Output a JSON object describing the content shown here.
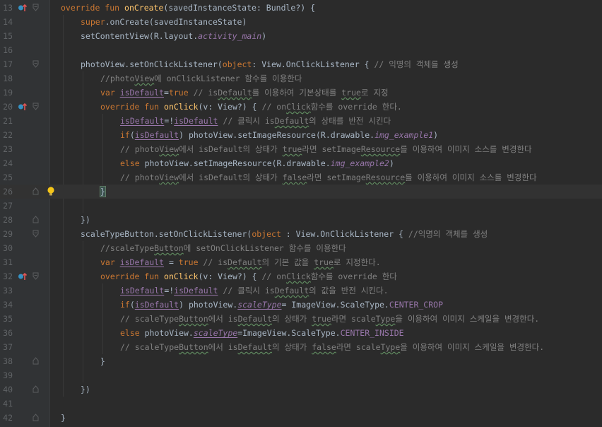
{
  "colors": {
    "background": "#2b2b2b",
    "gutter": "#313335",
    "keyword": "#cc7832",
    "function": "#ffc66d",
    "comment": "#808080",
    "field": "#9876aa",
    "text": "#a9b7c6",
    "line_number": "#606366"
  },
  "editor": {
    "lines": [
      {
        "num": "13",
        "marker": "override-up-icon",
        "fold": "fold-open-icon",
        "indent": 0,
        "tokens": [
          {
            "t": "override fun ",
            "c": "kw"
          },
          {
            "t": "onCreate",
            "c": "fn"
          },
          {
            "t": "(savedInstanceState: Bundle?) {",
            "c": ""
          }
        ]
      },
      {
        "num": "14",
        "indent": 1,
        "tokens": [
          {
            "t": "super",
            "c": "kw"
          },
          {
            "t": ".onCreate(savedInstanceState)",
            "c": ""
          }
        ]
      },
      {
        "num": "15",
        "indent": 1,
        "tokens": [
          {
            "t": "setContentView(R.layout.",
            "c": ""
          },
          {
            "t": "activity_main",
            "c": "res"
          },
          {
            "t": ")",
            "c": ""
          }
        ]
      },
      {
        "num": "16",
        "indent": 0,
        "tokens": []
      },
      {
        "num": "17",
        "fold": "fold-open-icon",
        "indent": 1,
        "tokens": [
          {
            "t": "photoView.setOnClickListener(",
            "c": ""
          },
          {
            "t": "object",
            "c": "kw"
          },
          {
            "t": ": View.OnClickListener { ",
            "c": ""
          },
          {
            "t": "// 익명의 객체를 생성",
            "c": "cm"
          }
        ]
      },
      {
        "num": "18",
        "indent": 2,
        "tokens": [
          {
            "t": "//photo",
            "c": "cm"
          },
          {
            "t": "View",
            "c": "cm squig"
          },
          {
            "t": "에 onClickListener 함수를 이용한다",
            "c": "cm"
          }
        ]
      },
      {
        "num": "19",
        "indent": 2,
        "tokens": [
          {
            "t": "var ",
            "c": "kw"
          },
          {
            "t": "isDefault",
            "c": "prop uline"
          },
          {
            "t": "=",
            "c": ""
          },
          {
            "t": "true ",
            "c": "kw"
          },
          {
            "t": "// is",
            "c": "cm"
          },
          {
            "t": "Default",
            "c": "cm squig"
          },
          {
            "t": "를 이용하여 기본상태를 ",
            "c": "cm"
          },
          {
            "t": "true",
            "c": "cm squig"
          },
          {
            "t": "로 지정",
            "c": "cm"
          }
        ]
      },
      {
        "num": "20",
        "marker": "override-up-icon",
        "fold": "fold-open-icon",
        "indent": 2,
        "tokens": [
          {
            "t": "override fun ",
            "c": "kw"
          },
          {
            "t": "onClick",
            "c": "fn"
          },
          {
            "t": "(v: View?) ",
            "c": ""
          },
          {
            "t": "{",
            "c": "brace"
          },
          {
            "t": " // on",
            "c": "cm"
          },
          {
            "t": "Click",
            "c": "cm squig"
          },
          {
            "t": "함수를 override 한다.",
            "c": "cm"
          }
        ]
      },
      {
        "num": "21",
        "indent": 3,
        "tokens": [
          {
            "t": "isDefault",
            "c": "prop uline"
          },
          {
            "t": "=!",
            "c": ""
          },
          {
            "t": "isDefault",
            "c": "prop uline"
          },
          {
            "t": " // 클릭시 is",
            "c": "cm"
          },
          {
            "t": "Default",
            "c": "cm squig"
          },
          {
            "t": "의 상태를 반전 시킨다",
            "c": "cm"
          }
        ]
      },
      {
        "num": "22",
        "indent": 3,
        "tokens": [
          {
            "t": "if",
            "c": "kw"
          },
          {
            "t": "(",
            "c": ""
          },
          {
            "t": "isDefault",
            "c": "prop uline"
          },
          {
            "t": ") photoView.setImageResource(R.drawable.",
            "c": ""
          },
          {
            "t": "img_example1",
            "c": "res"
          },
          {
            "t": ")",
            "c": ""
          }
        ]
      },
      {
        "num": "23",
        "indent": 3,
        "tokens": [
          {
            "t": "// photo",
            "c": "cm"
          },
          {
            "t": "View",
            "c": "cm squig"
          },
          {
            "t": "에서 isDefault의 상태가 ",
            "c": "cm"
          },
          {
            "t": "true",
            "c": "cm squig"
          },
          {
            "t": "라면 setImage",
            "c": "cm"
          },
          {
            "t": "Resource",
            "c": "cm squig"
          },
          {
            "t": "를 이용하여 이미지 소스를 변경한다",
            "c": "cm"
          }
        ]
      },
      {
        "num": "24",
        "indent": 3,
        "tokens": [
          {
            "t": "else ",
            "c": "kw"
          },
          {
            "t": "photoView.setImageResource(R.drawable.",
            "c": ""
          },
          {
            "t": "img_example2",
            "c": "res"
          },
          {
            "t": ")",
            "c": ""
          }
        ]
      },
      {
        "num": "25",
        "indent": 3,
        "tokens": [
          {
            "t": "// photo",
            "c": "cm"
          },
          {
            "t": "View",
            "c": "cm squig"
          },
          {
            "t": "에서 isDefault의 상태가 ",
            "c": "cm"
          },
          {
            "t": "false",
            "c": "cm squig"
          },
          {
            "t": "라면 setImage",
            "c": "cm"
          },
          {
            "t": "Resource",
            "c": "cm squig"
          },
          {
            "t": "를 이용하여 이미지 소스를 변경한다",
            "c": "cm"
          }
        ]
      },
      {
        "num": "26",
        "fold": "fold-close-icon",
        "bulb": "lightbulb-icon",
        "current": true,
        "indent": 2,
        "tokens": [
          {
            "t": "}",
            "c": "brace"
          }
        ]
      },
      {
        "num": "27",
        "indent": 0,
        "tokens": []
      },
      {
        "num": "28",
        "fold": "fold-close-icon",
        "indent": 1,
        "tokens": [
          {
            "t": "})",
            "c": ""
          }
        ]
      },
      {
        "num": "29",
        "fold": "fold-open-icon",
        "indent": 1,
        "tokens": [
          {
            "t": "scaleTypeButton.setOnClickListener(",
            "c": ""
          },
          {
            "t": "object",
            "c": "kw"
          },
          {
            "t": " : View.OnClickListener { ",
            "c": ""
          },
          {
            "t": "//익명의 객체를 생성",
            "c": "cm"
          }
        ]
      },
      {
        "num": "30",
        "indent": 2,
        "tokens": [
          {
            "t": "//scaleType",
            "c": "cm"
          },
          {
            "t": "Button",
            "c": "cm squig"
          },
          {
            "t": "에 setOnClickListener 함수를 이용한다",
            "c": "cm"
          }
        ]
      },
      {
        "num": "31",
        "indent": 2,
        "tokens": [
          {
            "t": "var ",
            "c": "kw"
          },
          {
            "t": "isDefault",
            "c": "prop uline"
          },
          {
            "t": " = ",
            "c": ""
          },
          {
            "t": "true ",
            "c": "kw"
          },
          {
            "t": "// is",
            "c": "cm"
          },
          {
            "t": "Default",
            "c": "cm squig"
          },
          {
            "t": "의 기본 값을 ",
            "c": "cm"
          },
          {
            "t": "true",
            "c": "cm squig"
          },
          {
            "t": "로 지정한다.",
            "c": "cm"
          }
        ]
      },
      {
        "num": "32",
        "marker": "override-up-icon",
        "fold": "fold-open-icon",
        "indent": 2,
        "tokens": [
          {
            "t": "override fun ",
            "c": "kw"
          },
          {
            "t": "onClick",
            "c": "fn"
          },
          {
            "t": "(v: View?) { ",
            "c": ""
          },
          {
            "t": "// on",
            "c": "cm"
          },
          {
            "t": "Click",
            "c": "cm squig"
          },
          {
            "t": "함수를 override 한다",
            "c": "cm"
          }
        ]
      },
      {
        "num": "33",
        "indent": 3,
        "tokens": [
          {
            "t": "isDefault",
            "c": "prop uline"
          },
          {
            "t": "=!",
            "c": ""
          },
          {
            "t": "isDefault",
            "c": "prop uline"
          },
          {
            "t": " // 클릭시 is",
            "c": "cm"
          },
          {
            "t": "Default",
            "c": "cm squig"
          },
          {
            "t": "의 값을 반전 시킨다.",
            "c": "cm"
          }
        ]
      },
      {
        "num": "34",
        "indent": 3,
        "tokens": [
          {
            "t": "if",
            "c": "kw"
          },
          {
            "t": "(",
            "c": ""
          },
          {
            "t": "isDefault",
            "c": "prop uline"
          },
          {
            "t": ") photoView.",
            "c": ""
          },
          {
            "t": "scaleType",
            "c": "res uline"
          },
          {
            "t": "= ImageView.ScaleType.",
            "c": ""
          },
          {
            "t": "CENTER_CROP",
            "c": "prop"
          }
        ]
      },
      {
        "num": "35",
        "indent": 3,
        "tokens": [
          {
            "t": "// scaleType",
            "c": "cm"
          },
          {
            "t": "Button",
            "c": "cm squig"
          },
          {
            "t": "에서 is",
            "c": "cm"
          },
          {
            "t": "Default",
            "c": "cm squig"
          },
          {
            "t": "의 상태가 ",
            "c": "cm"
          },
          {
            "t": "true",
            "c": "cm squig"
          },
          {
            "t": "라면 scale",
            "c": "cm"
          },
          {
            "t": "Type",
            "c": "cm squig"
          },
          {
            "t": "을 이용하여 이미지 스케일을 변경한다.",
            "c": "cm"
          }
        ]
      },
      {
        "num": "36",
        "indent": 3,
        "tokens": [
          {
            "t": "else ",
            "c": "kw"
          },
          {
            "t": "photoView.",
            "c": ""
          },
          {
            "t": "scaleType",
            "c": "res uline"
          },
          {
            "t": "=ImageView.ScaleType.",
            "c": ""
          },
          {
            "t": "CENTER_INSIDE",
            "c": "prop"
          }
        ]
      },
      {
        "num": "37",
        "indent": 3,
        "tokens": [
          {
            "t": "// scaleType",
            "c": "cm"
          },
          {
            "t": "Button",
            "c": "cm squig"
          },
          {
            "t": "에서 is",
            "c": "cm"
          },
          {
            "t": "Default",
            "c": "cm squig"
          },
          {
            "t": "의 상태가 ",
            "c": "cm"
          },
          {
            "t": "false",
            "c": "cm squig"
          },
          {
            "t": "라면 scale",
            "c": "cm"
          },
          {
            "t": "Type",
            "c": "cm squig"
          },
          {
            "t": "을 이용하여 이미지 스케일을 변경한다.",
            "c": "cm"
          }
        ]
      },
      {
        "num": "38",
        "fold": "fold-close-icon",
        "indent": 2,
        "tokens": [
          {
            "t": "}",
            "c": ""
          }
        ]
      },
      {
        "num": "39",
        "indent": 0,
        "tokens": []
      },
      {
        "num": "40",
        "fold": "fold-close-icon",
        "indent": 1,
        "tokens": [
          {
            "t": "})",
            "c": ""
          }
        ]
      },
      {
        "num": "41",
        "indent": 0,
        "tokens": []
      },
      {
        "num": "42",
        "fold": "fold-close-icon",
        "indent": 0,
        "tokens": [
          {
            "t": "}",
            "c": ""
          }
        ]
      }
    ]
  }
}
